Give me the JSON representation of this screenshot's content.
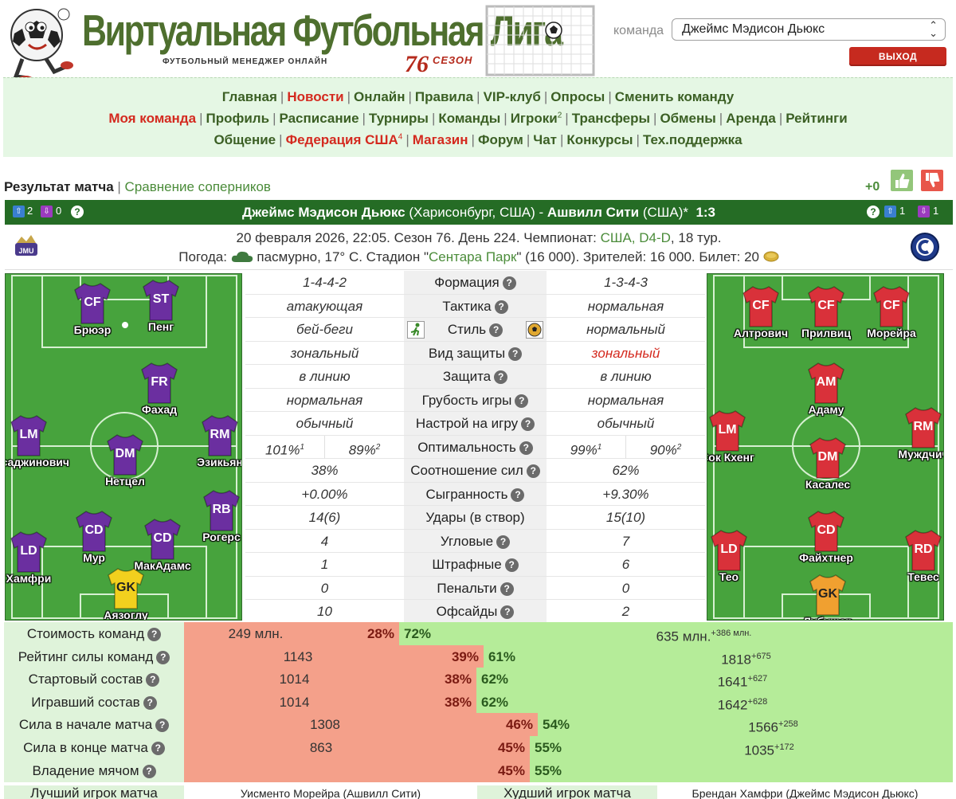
{
  "header": {
    "site_title": "Виртуальная Футбольная Лига",
    "subtitle": "ФУТБОЛЬНЫЙ МЕНЕДЖЕР ОНЛАЙН",
    "season_number": "76",
    "season_label": "СЕЗОН",
    "team_label": "команда",
    "team_selected": "Джеймс Мэдисон Дьюкс",
    "logout_label": "ВЫХОД"
  },
  "nav": {
    "row1": [
      "Главная",
      "Новости",
      "Онлайн",
      "Правила",
      "VIP-клуб",
      "Опросы",
      "Сменить команду"
    ],
    "row2": [
      "Моя команда",
      "Профиль",
      "Расписание",
      "Турниры",
      "Команды",
      "Игроки",
      "Трансферы",
      "Обмены",
      "Аренда",
      "Рейтинги"
    ],
    "row2_players_sup": "2",
    "row3": [
      "Общение",
      "Федерация США",
      "Магазин",
      "Форум",
      "Чат",
      "Конкурсы",
      "Тех.поддержка"
    ],
    "row3_federation_sup": "4"
  },
  "tabs": {
    "result": "Результат матча",
    "compare": "Сравнение соперников",
    "rating_plus": "+0"
  },
  "match": {
    "home_team": "Джеймс Мэдисон Дьюкс",
    "home_place": "(Харисонбург, США)",
    "away_team": "Ашвилл Сити",
    "away_place": "(США)*",
    "score": "1:3",
    "home_up": "2",
    "home_down": "0",
    "away_up": "1",
    "away_down": "1",
    "info_line1_prefix": "20 февраля 2026, 22:05. Сезон 76. День 224. Чемпионат:",
    "championship": "США, D4-D",
    "info_line1_suffix": ", 18 тур.",
    "info_line2_prefix": "Погода:",
    "weather": "пасмурно, 17° С. Стадион \"",
    "stadium": "Сентара Парк",
    "info_line2_suffix": "\" (16 000). Зрителей: 16 000. Билет: 20"
  },
  "home_players": [
    {
      "pos": "CF",
      "name": "Брюэр"
    },
    {
      "pos": "ST",
      "name": "Пенг"
    },
    {
      "pos": "FR",
      "name": "Фахад"
    },
    {
      "pos": "LM",
      "name": "Хусаджинович"
    },
    {
      "pos": "DM",
      "name": "Нетцел"
    },
    {
      "pos": "RM",
      "name": "Эзикьян"
    },
    {
      "pos": "RB",
      "name": "Рогерс"
    },
    {
      "pos": "CD",
      "name": "Мур"
    },
    {
      "pos": "CD",
      "name": "МакАдамс"
    },
    {
      "pos": "LD",
      "name": "Хамфри"
    },
    {
      "pos": "GK",
      "name": "Аязоглу"
    }
  ],
  "away_players": [
    {
      "pos": "CF",
      "name": "Алтрович"
    },
    {
      "pos": "CF",
      "name": "Прилвиц"
    },
    {
      "pos": "CF",
      "name": "Морейра"
    },
    {
      "pos": "AM",
      "name": "Адаму"
    },
    {
      "pos": "LM",
      "name": "Сок Кхенг"
    },
    {
      "pos": "DM",
      "name": "Касалес"
    },
    {
      "pos": "RM",
      "name": "Муждчич"
    },
    {
      "pos": "CD",
      "name": "Файхтнер"
    },
    {
      "pos": "LD",
      "name": "Тео"
    },
    {
      "pos": "RD",
      "name": "Тевес"
    },
    {
      "pos": "GK",
      "name": "Лубушер"
    }
  ],
  "stats": [
    {
      "label": "Формация",
      "home": "1-4-4-2",
      "away": "1-3-4-3"
    },
    {
      "label": "Тактика",
      "home": "атакующая",
      "away": "нормальная"
    },
    {
      "label": "Стиль",
      "home": "бей-беги",
      "away": "нормальный"
    },
    {
      "label": "Вид защиты",
      "home": "зональный",
      "away": "зональный"
    },
    {
      "label": "Защита",
      "home": "в линию",
      "away": "в линию"
    },
    {
      "label": "Грубость игры",
      "home": "нормальная",
      "away": "нормальная"
    },
    {
      "label": "Настрой на игру",
      "home": "обычный",
      "away": "обычный"
    },
    {
      "label": "Оптимальность",
      "home_a": "101%",
      "home_a_sup": "1",
      "home_b": "89%",
      "home_b_sup": "2",
      "away_a": "99%",
      "away_a_sup": "1",
      "away_b": "90%",
      "away_b_sup": "2"
    },
    {
      "label": "Соотношение сил",
      "home": "38%",
      "away": "62%"
    },
    {
      "label": "Сыгранность",
      "home": "+0.00%",
      "away": "+9.30%"
    },
    {
      "label": "Удары (в створ)",
      "home": "14(6)",
      "away": "15(10)"
    },
    {
      "label": "Угловые",
      "home": "4",
      "away": "7"
    },
    {
      "label": "Штрафные",
      "home": "1",
      "away": "6"
    },
    {
      "label": "Пенальти",
      "home": "0",
      "away": "0"
    },
    {
      "label": "Офсайды",
      "home": "10",
      "away": "2"
    }
  ],
  "compare": [
    {
      "label": "Стоимость команд",
      "home_val": "249 млн.",
      "home_pct": "28%",
      "away_pct": "72%",
      "away_val": "635 млн.",
      "away_sup": "+386 млн.",
      "home_share": 0.28
    },
    {
      "label": "Рейтинг силы команд",
      "home_val": "1143",
      "home_pct": "39%",
      "away_pct": "61%",
      "away_val": "1818",
      "away_sup": "+675",
      "home_share": 0.39
    },
    {
      "label": "Стартовый состав",
      "home_val": "1014",
      "home_pct": "38%",
      "away_pct": "62%",
      "away_val": "1641",
      "away_sup": "+627",
      "home_share": 0.38
    },
    {
      "label": "Игравший состав",
      "home_val": "1014",
      "home_pct": "38%",
      "away_pct": "62%",
      "away_val": "1642",
      "away_sup": "+628",
      "home_share": 0.38
    },
    {
      "label": "Сила в начале матча",
      "home_val": "1308",
      "home_pct": "46%",
      "away_pct": "54%",
      "away_val": "1566",
      "away_sup": "+258",
      "home_share": 0.46
    },
    {
      "label": "Сила в конце матча",
      "home_val": "863",
      "home_pct": "45%",
      "away_pct": "55%",
      "away_val": "1035",
      "away_sup": "+172",
      "home_share": 0.45
    },
    {
      "label": "Владение мячом",
      "home_val": "",
      "home_pct": "45%",
      "away_pct": "55%",
      "away_val": "",
      "away_sup": "",
      "home_share": 0.45
    }
  ],
  "best": {
    "best_label": "Лучший игрок матча",
    "best_player": "Уисменто Морейра (Ашвилл Сити)",
    "worst_label": "Худший игрок матча",
    "worst_player": "Брендан Хамфри (Джеймс Мэдисон Дьюкс)"
  },
  "colors": {
    "home_shirt": "#6b2fa0",
    "away_shirt": "#d9313a",
    "gk_home": "#f2d01e",
    "gk_away": "#f0a030",
    "pitch": "#47a33d",
    "bar_home": "#f4a08a",
    "bar_away": "#b5ec99"
  }
}
